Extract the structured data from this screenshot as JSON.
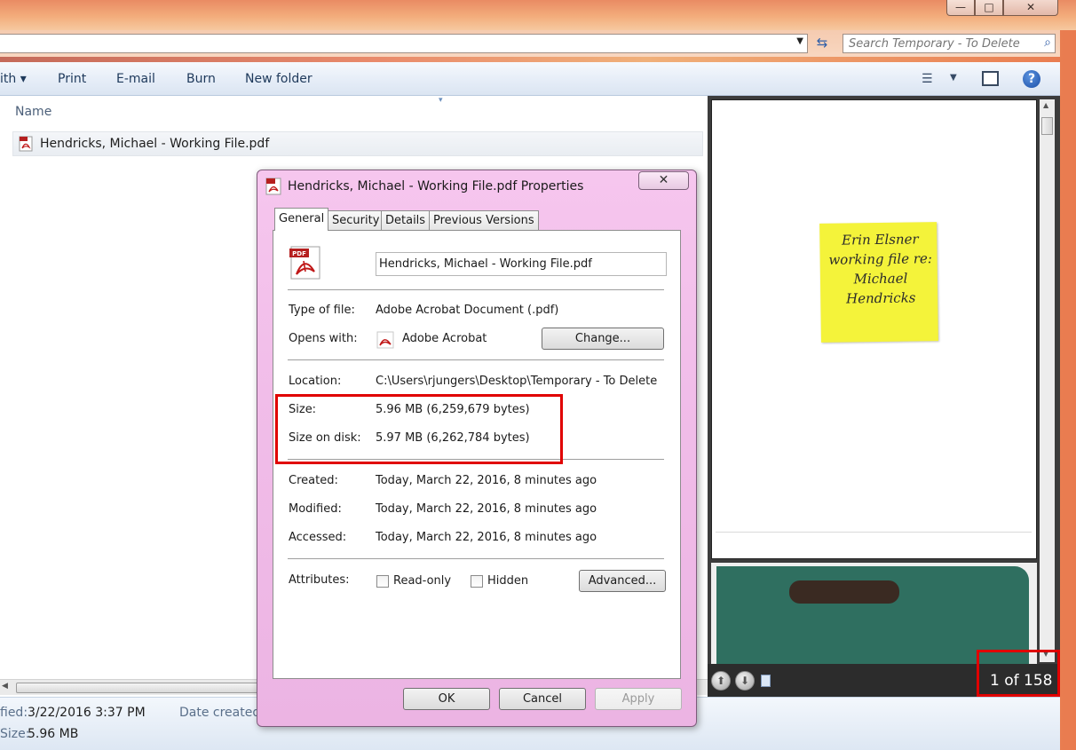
{
  "window": {
    "minimize_glyph": "—",
    "maximize_glyph": "□",
    "close_glyph": "✕"
  },
  "address": {
    "dropdown_glyph": "▼",
    "refresh_glyph": "⇆",
    "search_placeholder": "Search Temporary - To Delete",
    "search_glyph": "⌕"
  },
  "toolbar": {
    "open_with": "ith ▾",
    "print": "Print",
    "email": "E-mail",
    "burn": "Burn",
    "new_folder": "New folder",
    "views_glyph": "☰",
    "views_arrow": "▼",
    "help_glyph": "?"
  },
  "filelist": {
    "column_name": "Name",
    "sort_glyph": "▾",
    "file_name": "Hendricks, Michael - Working File.pdf",
    "scroll_left_glyph": "◀"
  },
  "details": {
    "modified_label": "fied:",
    "modified_value": "3/22/2016 3:37 PM",
    "date_created_label": "Date created",
    "size_label": "Size:",
    "size_value": "5.96 MB"
  },
  "preview": {
    "sticky_note_lines": "Erin Elsner working file re: Michael Hendricks",
    "page_counter": "1 of 158",
    "up_glyph": "⬆",
    "down_glyph": "⬇",
    "scroll_up_glyph": "▲",
    "scroll_down_glyph": "▼"
  },
  "dialog": {
    "title": "Hendricks, Michael - Working File.pdf Properties",
    "close_glyph": "✕",
    "tabs": {
      "general": "General",
      "security": "Security",
      "details": "Details",
      "previous_versions": "Previous Versions"
    },
    "filename": "Hendricks, Michael - Working File.pdf",
    "type_label": "Type of file:",
    "type_value": "Adobe Acrobat Document (.pdf)",
    "opens_label": "Opens with:",
    "opens_value": "Adobe Acrobat",
    "change_button": "Change...",
    "location_label": "Location:",
    "location_value": "C:\\Users\\rjungers\\Desktop\\Temporary - To Delete",
    "size_label": "Size:",
    "size_value": "5.96 MB (6,259,679 bytes)",
    "size_on_disk_label": "Size on disk:",
    "size_on_disk_value": "5.97 MB (6,262,784 bytes)",
    "created_label": "Created:",
    "created_value": "Today, March 22, 2016, 8 minutes ago",
    "modified_label": "Modified:",
    "modified_value": "Today, March 22, 2016, 8 minutes ago",
    "accessed_label": "Accessed:",
    "accessed_value": "Today, March 22, 2016, 8 minutes ago",
    "attributes_label": "Attributes:",
    "readonly_label": "Read-only",
    "hidden_label": "Hidden",
    "advanced_button": "Advanced...",
    "ok_button": "OK",
    "cancel_button": "Cancel",
    "apply_button": "Apply"
  },
  "colors": {
    "highlight_red": "#e00000",
    "dialog_frame": "#f1bde9",
    "sticky_yellow": "#f4f33a",
    "folder_green": "#2f6f60"
  }
}
